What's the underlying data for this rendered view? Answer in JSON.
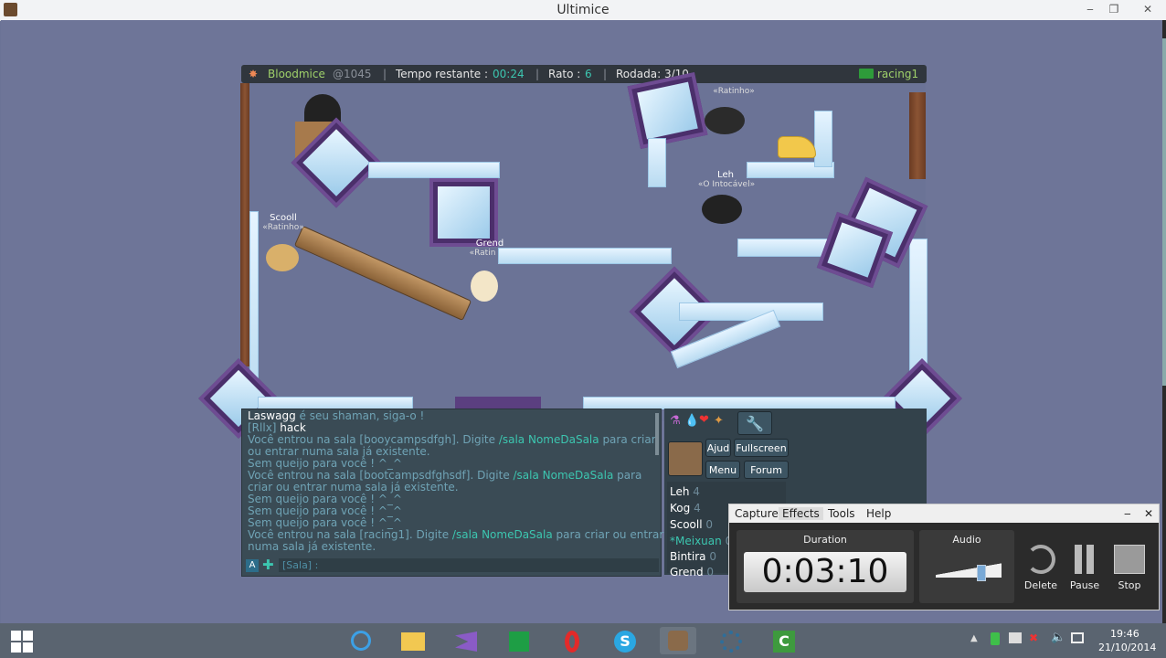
{
  "window": {
    "title": "Ultimice",
    "minimize": "‒",
    "restore": "❐",
    "close": "✕"
  },
  "hud": {
    "map_name": "Bloodmice",
    "map_code": "@1045",
    "time_label": "Tempo restante :",
    "time_value": "00:24",
    "mice_label": "Rato :",
    "mice_value": "6",
    "round_label": "Rodada: 3/10",
    "room": "racing1"
  },
  "players_on_map": [
    {
      "name": "Scooll",
      "title": "«Ratinho»"
    },
    {
      "name": "Grend",
      "title": "«Ratin"
    },
    {
      "name": "Leh",
      "title": "«O Intocável»"
    },
    {
      "name": "",
      "title": "«Ratinho»"
    }
  ],
  "chat": {
    "lines": [
      {
        "a": "Laswagg",
        "b": " é seu shaman, siga-o !",
        "c": "",
        "d": ""
      },
      {
        "a": "[Rllx] ",
        "b": "hack",
        "c": "",
        "d": ""
      },
      {
        "a": "Você entrou na sala [booycampsdfgh]. Digite ",
        "b": "/sala NomeDaSala",
        "c": " para criar",
        "d": ""
      },
      {
        "a": "ou entrar numa sala já existente.",
        "b": "",
        "c": "",
        "d": ""
      },
      {
        "a": "Sem queijo para você ! ^_^",
        "b": "",
        "c": "",
        "d": ""
      },
      {
        "a": "Você entrou na sala [bootcampsdfghsdf]. Digite ",
        "b": "/sala NomeDaSala",
        "c": " para",
        "d": ""
      },
      {
        "a": "criar ou entrar numa sala já existente.",
        "b": "",
        "c": "",
        "d": ""
      },
      {
        "a": "Sem queijo para você ! ^_^",
        "b": "",
        "c": "",
        "d": ""
      },
      {
        "a": "Sem queijo para você ! ^_^",
        "b": "",
        "c": "",
        "d": ""
      },
      {
        "a": "Sem queijo para você ! ^_^",
        "b": "",
        "c": "",
        "d": ""
      },
      {
        "a": "Você entrou na sala [racing1]. Digite ",
        "b": "/sala NomeDaSala",
        "c": " para criar ou entrar",
        "d": ""
      },
      {
        "a": "numa sala já existente.",
        "b": "",
        "c": "",
        "d": ""
      }
    ],
    "input_prefix": "[Sala] :",
    "input_value": ""
  },
  "sidebar": {
    "help": "Ajud",
    "fullscreen": "Fullscreen",
    "menu": "Menu",
    "forum": "Forum",
    "players": [
      {
        "name": "Leh",
        "score": "4"
      },
      {
        "name": "Kog",
        "score": "4"
      },
      {
        "name": "Scooll",
        "score": "0"
      },
      {
        "name": "*Meixuan",
        "score": "0"
      },
      {
        "name": "Bintira",
        "score": "0"
      },
      {
        "name": "Grend",
        "score": "0"
      }
    ]
  },
  "recorder": {
    "menu": [
      "Capture",
      "Effects",
      "Tools",
      "Help"
    ],
    "duration_label": "Duration",
    "duration_value": "0:03:10",
    "audio_label": "Audio",
    "audio_level": 0.7,
    "delete": "Delete",
    "pause": "Pause",
    "stop": "Stop",
    "min": "‒",
    "close": "✕"
  },
  "taskbar": {
    "time": "19:46",
    "date": "21/10/2014",
    "apps": [
      "internet-explorer-icon",
      "file-explorer-icon",
      "visual-studio-icon",
      "store-icon",
      "opera-icon",
      "skype-icon",
      "ultimice-icon",
      "settings-icon",
      "camtasia-icon"
    ]
  }
}
